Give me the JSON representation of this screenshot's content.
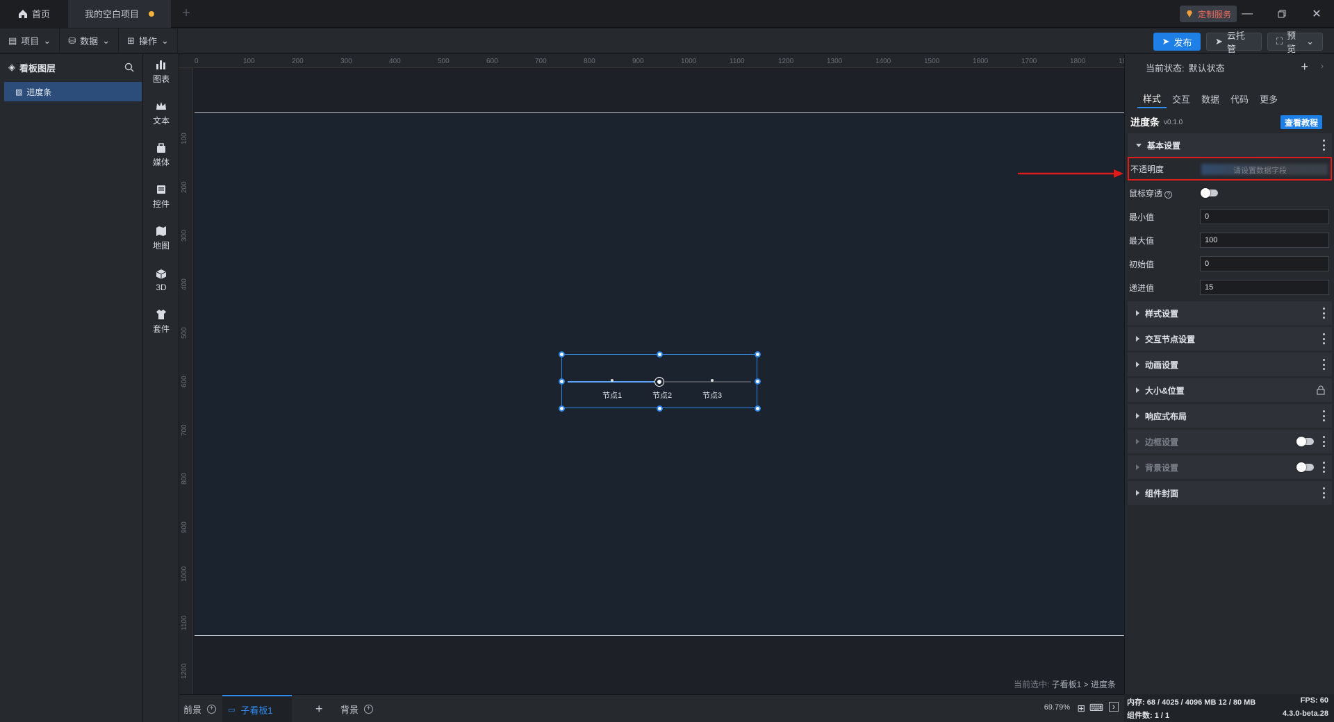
{
  "tabs": {
    "home": "首页",
    "project": "我的空白项目"
  },
  "header": {
    "custom_service": "定制服务"
  },
  "menu": {
    "project": "项目",
    "data": "数据",
    "operate": "操作"
  },
  "toolbar": {
    "publish": "发布",
    "cloud": "云托管",
    "preview": "预览"
  },
  "layers": {
    "title": "看板图层",
    "item": "进度条"
  },
  "rail": [
    "图表",
    "文本",
    "媒体",
    "控件",
    "地图",
    "3D",
    "套件"
  ],
  "ruler_h": [
    "0",
    "100",
    "200",
    "300",
    "400",
    "500",
    "600",
    "700",
    "800",
    "900",
    "1000",
    "1100",
    "1200",
    "1300",
    "1400",
    "1500",
    "1600",
    "1700",
    "1800",
    "1900"
  ],
  "ruler_v": [
    "100",
    "200",
    "300",
    "400",
    "500",
    "600",
    "700",
    "800",
    "900",
    "1000",
    "1100",
    "1200"
  ],
  "component": {
    "progress_percent": 50,
    "nodes": [
      "节点1",
      "节点2",
      "节点3"
    ]
  },
  "selection": {
    "prefix": "当前选中: ",
    "path": "子看板1 > 进度条"
  },
  "bottom": {
    "foreground": "前景",
    "board": "子看板1",
    "background": "背景",
    "zoom": "69.79%"
  },
  "props": {
    "state_label": "当前状态:",
    "state_value": "默认状态",
    "tabs": [
      "样式",
      "交互",
      "数据",
      "代码",
      "更多"
    ],
    "title": "进度条",
    "version": "v0.1.0",
    "tutorial": "查看教程",
    "basic": "基本设置",
    "opacity_label": "不透明度",
    "opacity_placeholder": "请设置数据字段",
    "mouse_through": "鼠标穿透",
    "min_label": "最小值",
    "min_value": "0",
    "max_label": "最大值",
    "max_value": "100",
    "init_label": "初始值",
    "init_value": "0",
    "step_label": "递进值",
    "step_value": "15",
    "sections": [
      "样式设置",
      "交互节点设置",
      "动画设置",
      "大小&位置",
      "响应式布局",
      "边框设置",
      "背景设置",
      "组件封面"
    ]
  },
  "info": {
    "memory": "内存: 68 / 4025 / 4096 MB  12 / 80 MB",
    "fps": "FPS: 60",
    "components": "组件数: 1 / 1",
    "version": "4.3.0-beta.28"
  },
  "colors": {
    "accent": "#1e7fe6",
    "highlight": "#e01b1b",
    "selection": "#2c4d7a"
  }
}
